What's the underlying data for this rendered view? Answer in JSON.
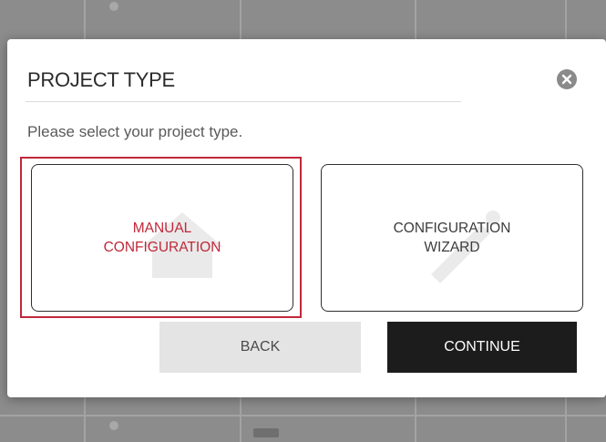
{
  "modal": {
    "title": "PROJECT TYPE",
    "subtitle": "Please select your project type.",
    "close_icon": "close-circle-icon"
  },
  "options": [
    {
      "label": "MANUAL\nCONFIGURATION",
      "selected": true
    },
    {
      "label": "CONFIGURATION\nWIZARD",
      "selected": false
    }
  ],
  "buttons": {
    "back_label": "BACK",
    "continue_label": "CONTINUE"
  },
  "colors": {
    "accent": "#c0283a",
    "continue_bg": "#1c1c1c",
    "back_bg": "#e4e4e4"
  }
}
